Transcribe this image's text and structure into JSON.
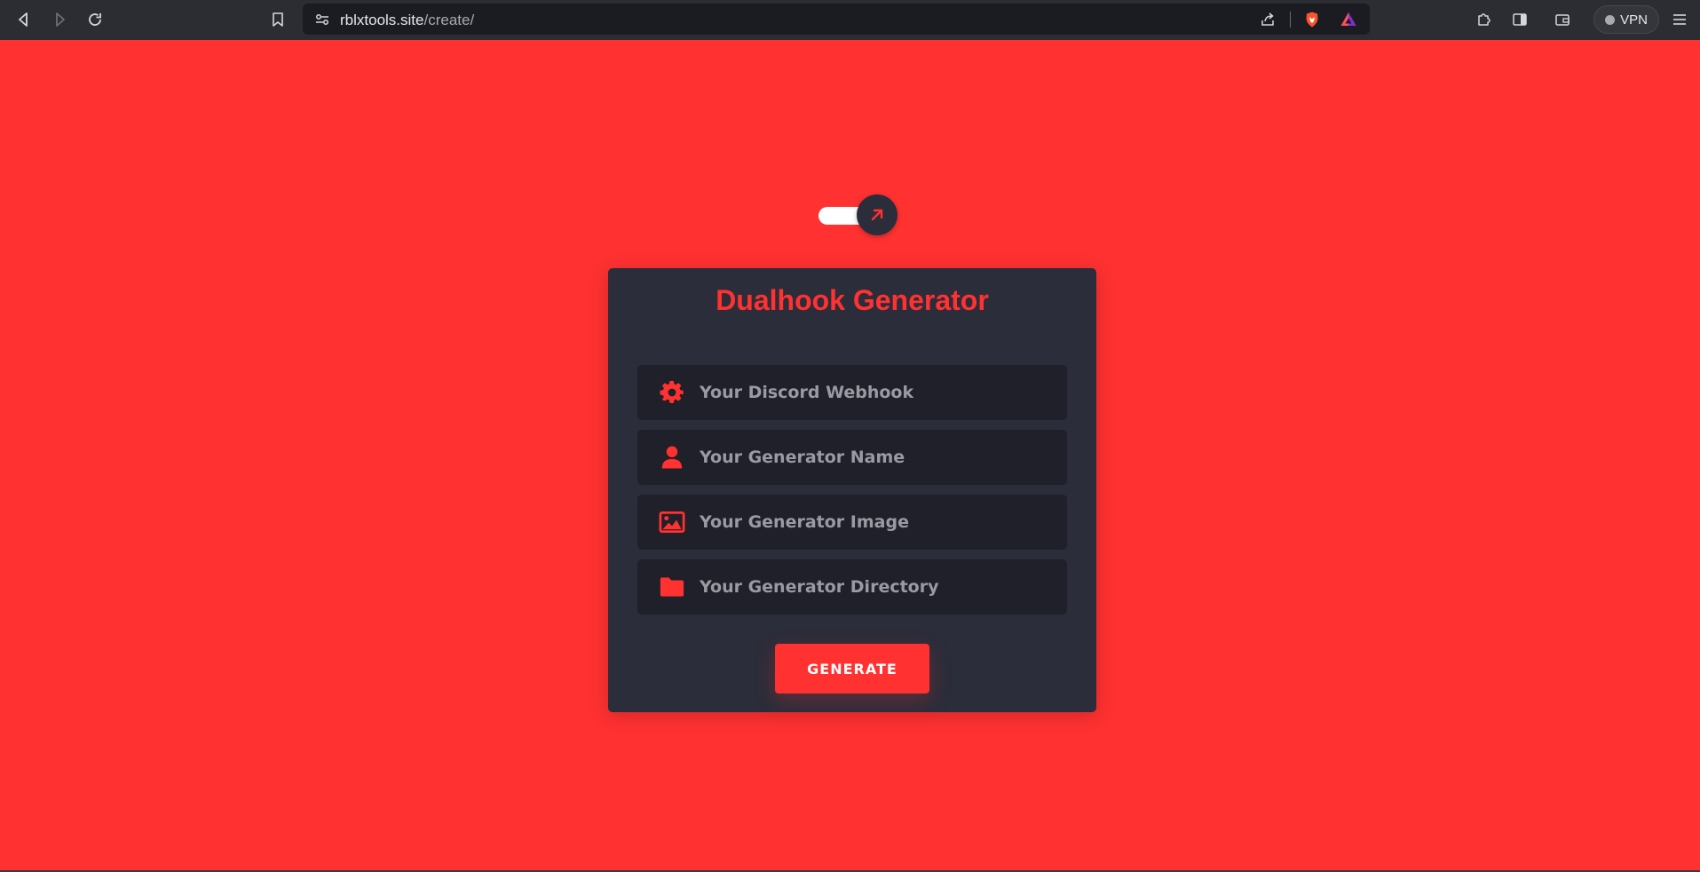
{
  "browser": {
    "url_host": "rblxtools.site",
    "url_path": "/create/",
    "vpn_label": "VPN"
  },
  "card": {
    "title": "Dualhook Generator",
    "fields": [
      {
        "placeholder": "Your Discord Webhook",
        "icon": "gear-icon"
      },
      {
        "placeholder": "Your Generator Name",
        "icon": "user-icon"
      },
      {
        "placeholder": "Your Generator Image",
        "icon": "image-icon"
      },
      {
        "placeholder": "Your Generator Directory",
        "icon": "folder-icon"
      }
    ],
    "generate_label": "GENERATE"
  },
  "colors": {
    "page_background": "#ff3131",
    "card_background": "#2b2d3a",
    "field_background": "#1f2029",
    "accent": "#ff3131",
    "browser_chrome": "#2b2d33"
  }
}
